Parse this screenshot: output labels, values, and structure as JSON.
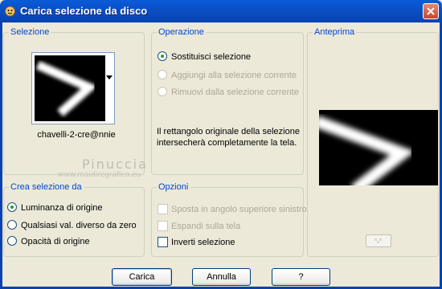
{
  "window": {
    "title": "Carica selezione da disco",
    "colors": {
      "title_bar": "#0a4fc4",
      "legend_text": "#0046d5",
      "face": "#ece9d8"
    }
  },
  "selezione": {
    "legend": "Selezione",
    "file_name": "chavelli-2-cre@nnie"
  },
  "operazione": {
    "legend": "Operazione",
    "options": [
      {
        "label": "Sostituisci selezione",
        "checked": true,
        "enabled": true
      },
      {
        "label": "Aggiungi alla selezione corrente",
        "checked": false,
        "enabled": false
      },
      {
        "label": "Rimuovi dalla selezione corrente",
        "checked": false,
        "enabled": false
      }
    ],
    "info_text": "Il rettangolo originale della selezione intersecherà completamente la tela."
  },
  "anteprima": {
    "legend": "Anteprima"
  },
  "crea_selezione": {
    "legend": "Crea selezione da",
    "options": [
      {
        "label": "Luminanza di origine",
        "checked": true
      },
      {
        "label": "Qualsiasi val. diverso da zero",
        "checked": false
      },
      {
        "label": "Opacità di origine",
        "checked": false
      }
    ]
  },
  "opzioni": {
    "legend": "Opzioni",
    "checks": [
      {
        "label": "Sposta in angolo superiore sinistro",
        "checked": false,
        "enabled": false
      },
      {
        "label": "Espandi sulla tela",
        "checked": false,
        "enabled": false
      },
      {
        "label": "Inverti selezione",
        "checked": false,
        "enabled": true
      }
    ]
  },
  "buttons": {
    "load": "Carica",
    "cancel": "Annulla",
    "help": "?"
  },
  "watermark": {
    "name": "Pinuccia",
    "site": "www.maidiregrafico.eu"
  }
}
